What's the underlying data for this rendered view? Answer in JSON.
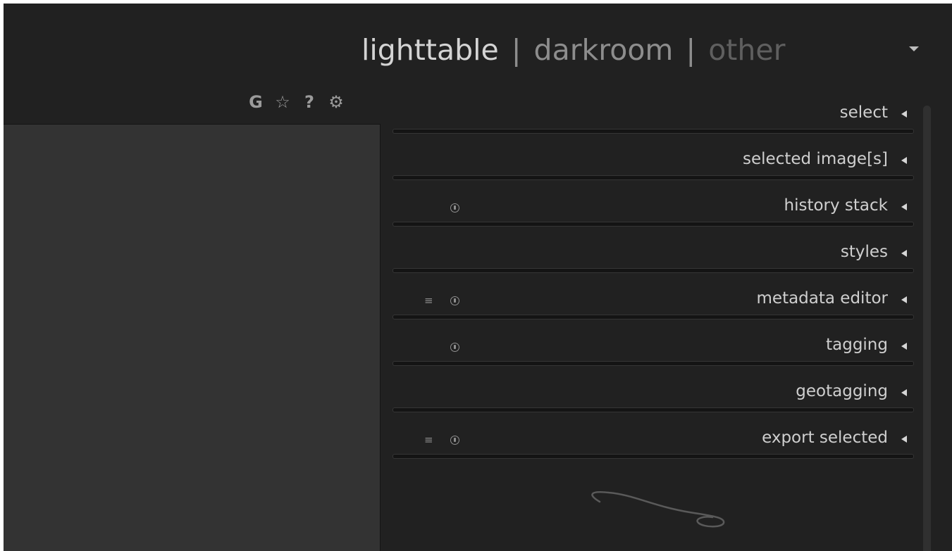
{
  "header": {
    "views": [
      {
        "label": "lighttable",
        "state": "active"
      },
      {
        "label": "darkroom",
        "state": "normal"
      },
      {
        "label": "other",
        "state": "dim"
      }
    ],
    "separator": "|",
    "dropdown_icon": "caret-down-icon"
  },
  "left_toolbar": {
    "items": [
      {
        "glyph": "G",
        "icon": "grouping-icon"
      },
      {
        "glyph": "☆",
        "icon": "star-icon"
      },
      {
        "glyph": "?",
        "icon": "help-icon"
      },
      {
        "glyph": "⚙",
        "icon": "gear-icon"
      }
    ]
  },
  "right_panel": {
    "modules": [
      {
        "label": "select",
        "presets": false,
        "reset": false
      },
      {
        "label": "selected image[s]",
        "presets": false,
        "reset": false
      },
      {
        "label": "history stack",
        "presets": false,
        "reset": true
      },
      {
        "label": "styles",
        "presets": false,
        "reset": false
      },
      {
        "label": "metadata editor",
        "presets": true,
        "reset": true
      },
      {
        "label": "tagging",
        "presets": false,
        "reset": true
      },
      {
        "label": "geotagging",
        "presets": false,
        "reset": false
      },
      {
        "label": "export selected",
        "presets": true,
        "reset": true
      }
    ],
    "preset_glyph": "≡"
  },
  "colors": {
    "background": "#212121",
    "left_panel": "#333333",
    "text": "#cfcfcf",
    "muted": "#8d8d8d"
  }
}
